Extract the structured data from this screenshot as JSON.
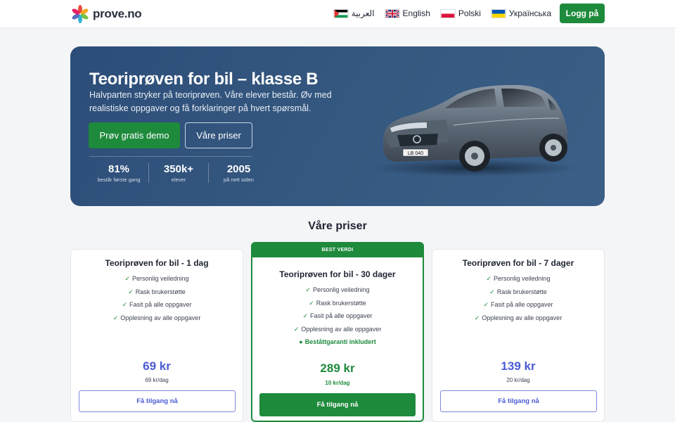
{
  "header": {
    "logo_text": "prove.no",
    "languages": [
      {
        "label": "العربية",
        "flag": "palestine-flag"
      },
      {
        "label": "English",
        "flag": "uk-flag"
      },
      {
        "label": "Polski",
        "flag": "poland-flag"
      },
      {
        "label": "Українська",
        "flag": "ukraine-flag"
      }
    ],
    "login_label": "Logg på"
  },
  "hero": {
    "title": "Teoriprøven for bil – klasse B",
    "subtitle": "Halvparten stryker på teoriprøven. Våre elever består. Øv med realistiske oppgaver og få forklaringer på hvert spørsmål.",
    "demo_button": "Prøv gratis demo",
    "prices_button": "Våre priser",
    "stats": [
      {
        "value": "81%",
        "label": "består første gang"
      },
      {
        "value": "350k+",
        "label": "elever"
      },
      {
        "value": "2005",
        "label": "på nett siden"
      }
    ],
    "car_plate": "LB 040"
  },
  "pricing": {
    "title": "Våre priser",
    "plans": [
      {
        "title": "Teoriprøven for bil - 1 dag",
        "features": [
          "Personlig veiledning",
          "Rask brukerstøtte",
          "Fasit på alle oppgaver",
          "Opplesning av alle oppgaver"
        ],
        "price": "69 kr",
        "per_day": "69 kr/dag",
        "button": "Få tilgang nå"
      },
      {
        "badge": "BEST VERDI",
        "title": "Teoriprøven for bil - 30 dager",
        "features": [
          "Personlig veiledning",
          "Rask brukerstøtte",
          "Fasit på alle oppgaver",
          "Opplesning av alle oppgaver"
        ],
        "extra_feature": "Beståttgaranti inkludert",
        "price": "289 kr",
        "per_day": "10 kr/dag",
        "button": "Få tilgang nå"
      },
      {
        "title": "Teoriprøven for bil - 7 dager",
        "features": [
          "Personlig veiledning",
          "Rask brukerstøtte",
          "Fasit på alle oppgaver",
          "Opplesning av alle oppgaver"
        ],
        "price": "139 kr",
        "per_day": "20 kr/dag",
        "button": "Få tilgang nå"
      }
    ]
  },
  "colors": {
    "brand_green": "#1e8a3c",
    "hero_blue": "#2c4d78",
    "price_purple": "#4b5bd6"
  }
}
